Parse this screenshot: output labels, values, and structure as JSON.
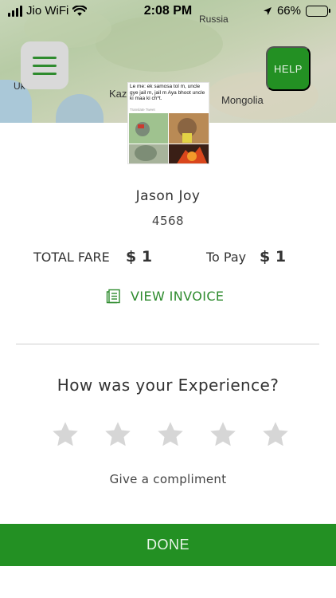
{
  "status_bar": {
    "carrier": "Jio WiFi",
    "time": "2:08 PM",
    "battery": "66%",
    "battery_level": 0.66
  },
  "map": {
    "labels": [
      "Russia",
      "Uk",
      "Kaz",
      "Mongolia"
    ]
  },
  "header": {
    "menu_icon": "hamburger-icon",
    "help_label": "HELP"
  },
  "driver": {
    "avatar_caption": "Le me: ek samosa tol m, uncle gye jail m, jail m Aya bhoot uncle ki maa ki ch*t.",
    "avatar_caption_sub": "Translate Tweet",
    "name": "Jason Joy",
    "code": "4568"
  },
  "fare": {
    "total_label": "TOTAL FARE",
    "total_value": "$ 1",
    "to_pay_label": "To Pay",
    "to_pay_value": "$ 1"
  },
  "invoice": {
    "icon": "invoice-icon",
    "label": "VIEW INVOICE"
  },
  "rating": {
    "question": "How was your Experience?",
    "stars": 5,
    "selected": 0,
    "compliment_label": "Give a compliment"
  },
  "done_label": "DONE",
  "colors": {
    "accent": "#239023",
    "star_inactive": "#d6d6d6",
    "text": "#333333"
  }
}
